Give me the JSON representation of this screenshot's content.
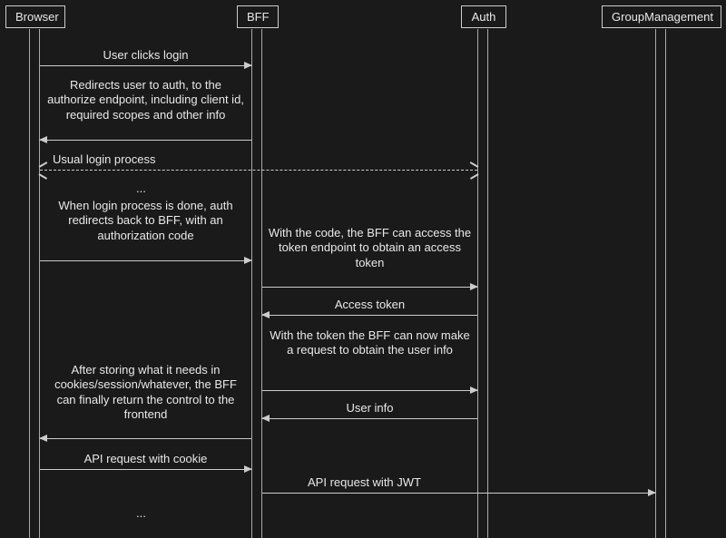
{
  "participants": {
    "browser": "Browser",
    "bff": "BFF",
    "auth": "Auth",
    "group": "GroupManagement"
  },
  "messages": {
    "m1": "User clicks login",
    "m2": "Redirects user to auth, to the authorize endpoint, including client id, required scopes and other info",
    "m3": "Usual login process",
    "m4": "When login process is done, auth redirects back to BFF, with an authorization code",
    "m5": "With the code, the BFF can access the token endpoint to obtain an access token",
    "m6": "Access token",
    "m7": "With the token the BFF can now make a request to obtain the user info",
    "m8": "User info",
    "m9": "After storing what it needs in cookies/session/whatever, the BFF can finally return the control to the frontend",
    "m10": "API request with cookie",
    "m11": "API request with JWT"
  },
  "ellipsis": "..."
}
